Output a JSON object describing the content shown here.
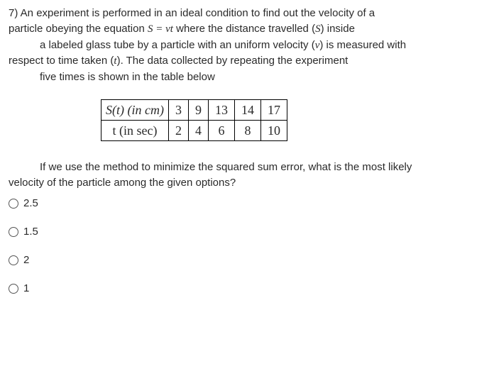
{
  "question": {
    "line1_a": "7) An experiment is performed in an ideal condition to find out the velocity of a",
    "line2_a": "particle obeying the equation ",
    "line2_eq": "S = vt",
    "line2_b": " where the distance travelled ",
    "line2_paren_open": "(",
    "line2_S": "S",
    "line2_paren_close": ")",
    "line2_c": " inside",
    "line3_a": "a labeled glass tube by a particle with an uniform velocity ",
    "line3_paren_open": "(",
    "line3_v": "v",
    "line3_paren_close": ")",
    "line3_b": " is measured with",
    "line4_a": "respect to time taken ",
    "line4_paren_open": "(",
    "line4_t": "t",
    "line4_paren_close": ")",
    "line4_b": ". The data collected by repeating the experiment",
    "line5": "five times is shown in the table below"
  },
  "table": {
    "row1_hdr": "S(t) (in cm)",
    "row2_hdr": "t (in sec)",
    "r1": [
      "3",
      "9",
      "13",
      "14",
      "17"
    ],
    "r2": [
      "2",
      "4",
      "6",
      "8",
      "10"
    ]
  },
  "followup": {
    "line1": "If we use the method to minimize the squared sum error, what is the most likely",
    "line2": "velocity of the particle among the given options?"
  },
  "options": {
    "a": "2.5",
    "b": "1.5",
    "c": "2",
    "d": "1"
  }
}
